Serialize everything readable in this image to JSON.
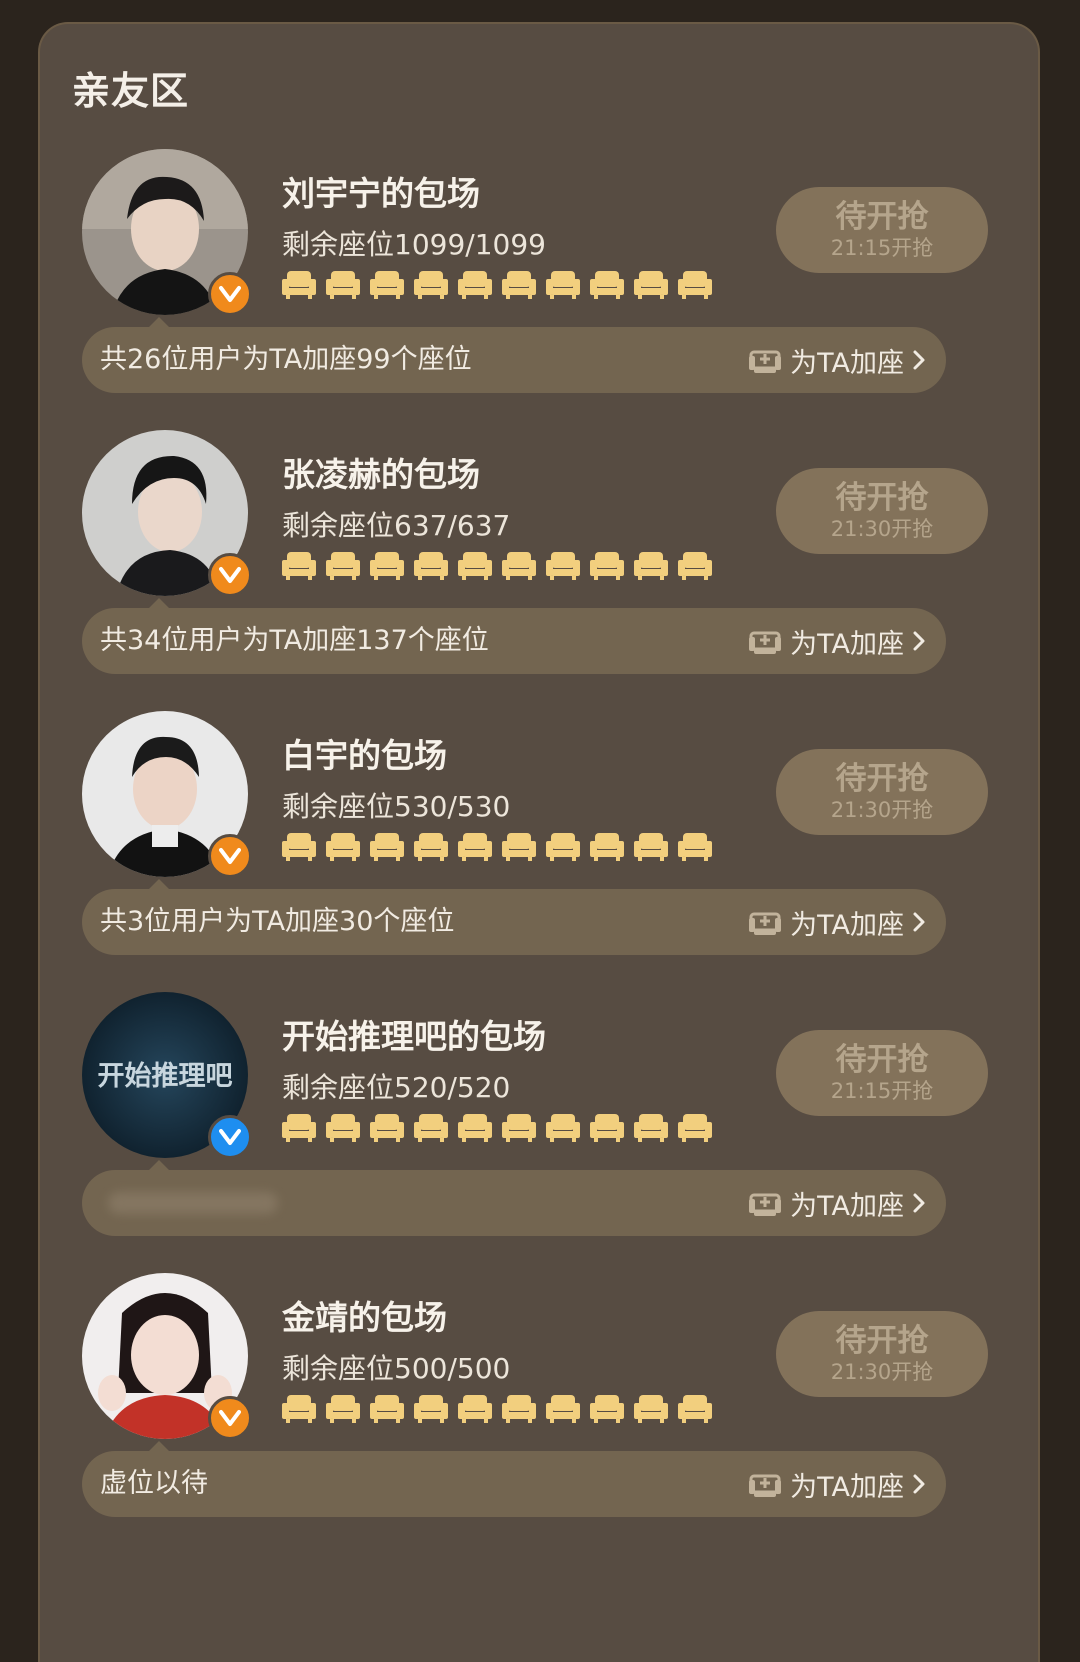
{
  "section": {
    "title": "亲友区"
  },
  "entries": [
    {
      "name": "刘宇宁的包场",
      "remaining": "剩余座位1099/1099",
      "button_main": "待开抢",
      "button_time": "21:15开抢",
      "summary": "共26位用户为TA加座99个座位",
      "add_label": "为TA加座",
      "badge_color": "#f08a1c"
    },
    {
      "name": "张凌赫的包场",
      "remaining": "剩余座位637/637",
      "button_main": "待开抢",
      "button_time": "21:30开抢",
      "summary": "共34位用户为TA加座137个座位",
      "add_label": "为TA加座",
      "badge_color": "#f08a1c"
    },
    {
      "name": "白宇的包场",
      "remaining": "剩余座位530/530",
      "button_main": "待开抢",
      "button_time": "21:30开抢",
      "summary": "共3位用户为TA加座30个座位",
      "add_label": "为TA加座",
      "badge_color": "#f08a1c"
    },
    {
      "name": "开始推理吧的包场",
      "remaining": "剩余座位520/520",
      "button_main": "待开抢",
      "button_time": "21:15开抢",
      "summary": "",
      "add_label": "为TA加座",
      "badge_color": "#1e8ef0",
      "avatar_text": "开始推理吧"
    },
    {
      "name": "金靖的包场",
      "remaining": "剩余座位500/500",
      "button_main": "待开抢",
      "button_time": "21:30开抢",
      "summary": "虚位以待",
      "add_label": "为TA加座",
      "badge_color": "#f08a1c"
    }
  ],
  "icons": {
    "seat": "seat-icon",
    "add_seat": "add-seat-icon",
    "chevron": "chevron-right-icon",
    "verified": "verified-badge-icon"
  },
  "colors": {
    "panel": "#574c42",
    "bar": "#736550",
    "button": "#83725a",
    "seat": "#f2cf7e"
  }
}
